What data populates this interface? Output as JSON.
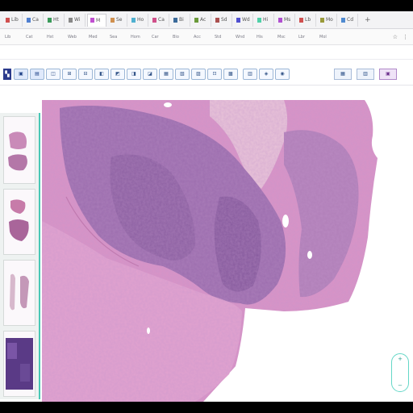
{
  "browser": {
    "tabs": [
      {
        "label": "Lib",
        "color": "#d04f4f",
        "active": false
      },
      {
        "label": "Ca",
        "color": "#4f7fd0",
        "active": false
      },
      {
        "label": "Ht",
        "color": "#3a9a5a",
        "active": false
      },
      {
        "label": "Wi",
        "color": "#888888",
        "active": false
      },
      {
        "label": "M",
        "color": "#c04fd0",
        "active": true
      },
      {
        "label": "Se",
        "color": "#d0904f",
        "active": false
      },
      {
        "label": "Ho",
        "color": "#4fb0d0",
        "active": false
      },
      {
        "label": "Ca",
        "color": "#d04f8a",
        "active": false
      },
      {
        "label": "Bi",
        "color": "#3a6a9a",
        "active": false
      },
      {
        "label": "Ac",
        "color": "#6a9a3a",
        "active": false
      },
      {
        "label": "Sd",
        "color": "#aa4f4f",
        "active": false
      },
      {
        "label": "Wd",
        "color": "#4f4fd0",
        "active": false
      },
      {
        "label": "Hi",
        "color": "#4fd0a8",
        "active": false
      },
      {
        "label": "Ms",
        "color": "#b04fd0",
        "active": false
      },
      {
        "label": "Lb",
        "color": "#d04f4f",
        "active": false
      },
      {
        "label": "Mo",
        "color": "#9a9a3a",
        "active": false
      },
      {
        "label": "Cd",
        "color": "#4f8ad0",
        "active": false
      }
    ],
    "new_tab": "+",
    "bookmarks": [
      "Lib",
      "Cat",
      "Hst",
      "Web",
      "Med",
      "Sea",
      "Hom",
      "Car",
      "Bio",
      "Acc",
      "Std",
      "Wnd",
      "His",
      "Msc",
      "Lbr",
      "Mol"
    ],
    "nav_icons": [
      "☆",
      "⋮"
    ]
  },
  "viewer": {
    "status_texts": [
      "",
      "",
      "",
      ""
    ],
    "tools_left": [
      "▣",
      "▤",
      "◫",
      "⊞",
      "⊟",
      "◧",
      "◩",
      "◨",
      "◪",
      "▦",
      "▧",
      "▨",
      "⊡",
      "▩"
    ],
    "tools_left_group2": [
      "▥",
      "◈",
      "◉"
    ],
    "tools_right": [
      "▦",
      "▥",
      "▣"
    ],
    "zoom_in": "+",
    "zoom_out": "−"
  },
  "thumbnails": [
    {
      "label": ""
    },
    {
      "label": ""
    },
    {
      "label": ""
    },
    {
      "label": ""
    }
  ],
  "colors": {
    "tissue_base": "#d993c6",
    "tissue_dense": "#8a5aa0",
    "tissue_light": "#e6b6d4",
    "accent": "#49c7b6"
  }
}
